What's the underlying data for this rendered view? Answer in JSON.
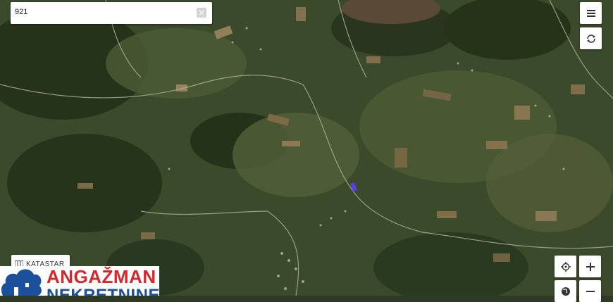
{
  "search": {
    "value": "921",
    "clear_icon": "close-icon"
  },
  "toolbar": {
    "menu_icon": "menu-icon",
    "refresh_icon": "refresh-icon"
  },
  "layer_button": {
    "label": "KATASTAR",
    "icon": "map-layers-icon"
  },
  "zoom_controls": {
    "locate_icon": "locate-icon",
    "zoom_in_icon": "plus-icon",
    "globe_icon": "globe-icon",
    "zoom_out_icon": "minus-icon"
  },
  "branding": {
    "line1": "ANGAŽMAN",
    "line2": "NEKRETNINE",
    "colors": {
      "line1": "#d9262b",
      "line2": "#1c4f9c"
    }
  },
  "map": {
    "type": "satellite",
    "marker_color": "#5a3fe0"
  }
}
